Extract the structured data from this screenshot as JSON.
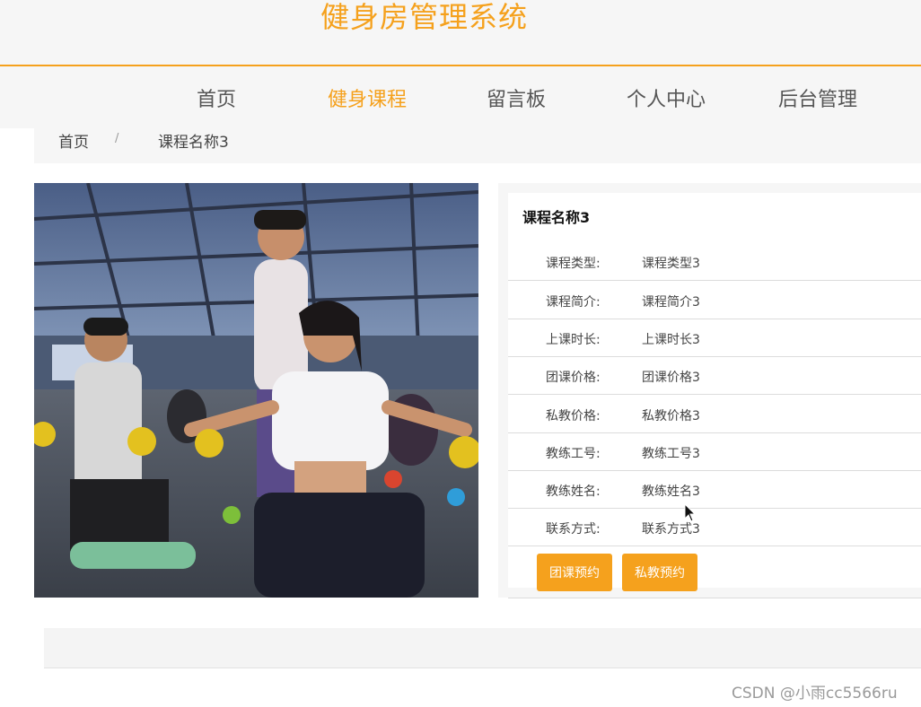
{
  "header": {
    "site_title": "健身房管理系统"
  },
  "nav": {
    "items": [
      {
        "label": "首页",
        "active": false
      },
      {
        "label": "健身课程",
        "active": true
      },
      {
        "label": "留言板",
        "active": false
      },
      {
        "label": "个人中心",
        "active": false
      },
      {
        "label": "后台管理",
        "active": false
      }
    ]
  },
  "breadcrumb": {
    "home": "首页",
    "separator": "/",
    "current": "课程名称3"
  },
  "detail": {
    "title": "课程名称3",
    "rows": [
      {
        "label": "课程类型:",
        "value": "课程类型3"
      },
      {
        "label": "课程简介:",
        "value": "课程简介3"
      },
      {
        "label": "上课时长:",
        "value": "上课时长3"
      },
      {
        "label": "团课价格:",
        "value": "团课价格3"
      },
      {
        "label": "私教价格:",
        "value": "私教价格3"
      },
      {
        "label": "教练工号:",
        "value": "教练工号3"
      },
      {
        "label": "教练姓名:",
        "value": "教练姓名3"
      },
      {
        "label": "联系方式:",
        "value": "联系方式3"
      }
    ],
    "buttons": {
      "group_booking": "团课预约",
      "private_booking": "私教预约"
    }
  },
  "watermark": "CSDN @小雨cc5566ru",
  "colors": {
    "accent": "#f5a11d",
    "panel_bg": "#f6f6f6"
  }
}
